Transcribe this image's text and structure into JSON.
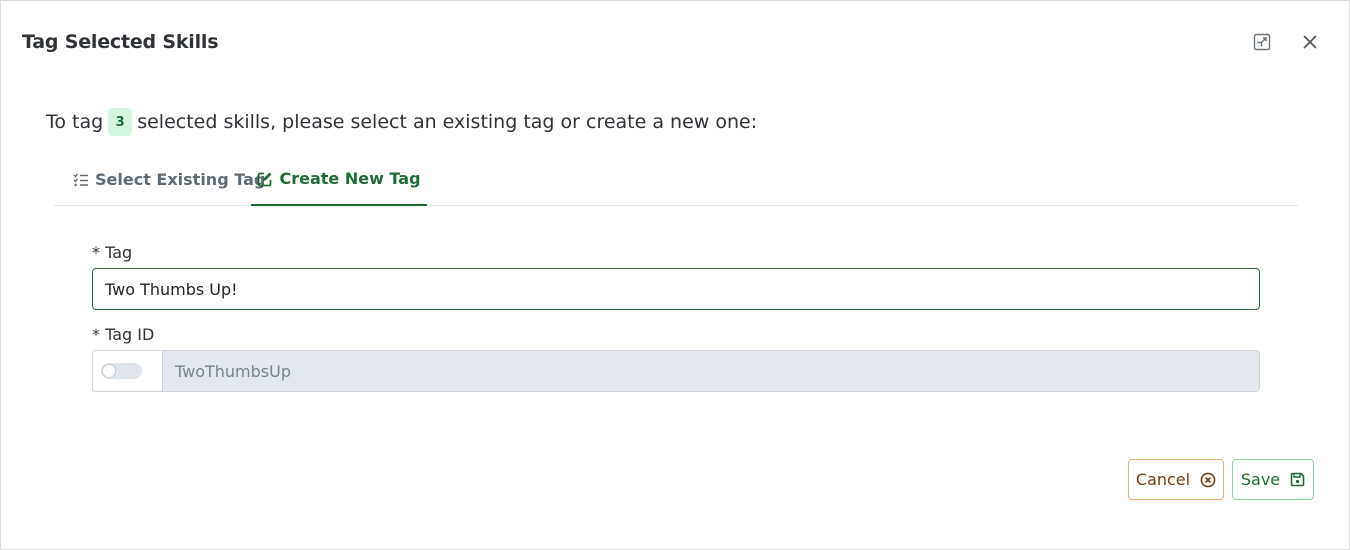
{
  "dialog": {
    "title": "Tag Selected Skills",
    "minimize_icon": "window-restore-icon",
    "close_icon": "close-icon"
  },
  "intro": {
    "prefix": "To tag",
    "count": "3",
    "suffix": "selected skills, please select an existing tag or create a new one:"
  },
  "tabs": [
    {
      "label": "Select Existing Tag",
      "icon": "list-check-icon",
      "active": false
    },
    {
      "label": "Create New Tag",
      "icon": "edit-icon",
      "active": true
    }
  ],
  "form": {
    "tag_label": "* Tag",
    "tag_value": "Two Thumbs Up!",
    "tag_id_label": "* Tag ID",
    "tag_id_value": "TwoThumbsUp",
    "tag_id_toggle_on": false
  },
  "actions": {
    "cancel_label": "Cancel",
    "cancel_icon": "circle-x-icon",
    "save_label": "Save",
    "save_icon": "floppy-disk-icon"
  },
  "colors": {
    "accent": "#1e6b35",
    "cancel": "#7a3b16",
    "badge_bg": "#d6f5e0"
  }
}
